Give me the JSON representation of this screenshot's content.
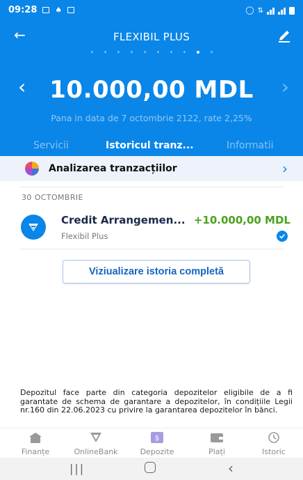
{
  "status_bar": {
    "time": "09:28"
  },
  "header": {
    "title": "FLEXIBIL PLUS",
    "amount": "10.000,00 MDL",
    "subtitle": "Pana in data de 7 octombrie 2122, rate 2,25%",
    "page_dots_total": 10,
    "page_dots_active": 9
  },
  "tabs": [
    {
      "label": "Servicii",
      "active": false
    },
    {
      "label": "Istoricul tranz...",
      "active": true
    },
    {
      "label": "Informatii",
      "active": false
    }
  ],
  "analyze": {
    "label": "Analizarea tranzacțiilor"
  },
  "date_group": "30 OCTOMBRIE",
  "transaction": {
    "title": "Credit Arrangemen...",
    "amount": "+10.000,00 MDL",
    "subtitle": "Flexibil Plus",
    "amount_color": "#4aa21d"
  },
  "full_history_button": "Viziualizare istoria completă",
  "disclaimer": "Depozitul face parte din categoria depozitelor eligibile de a fi garantate de schema de garantare a depozitelor, în condițiile Legii nr.160 din 22.06.2023 cu privire la garantarea depozitelor în bănci.",
  "bottom_nav": [
    {
      "label": "Finanțe",
      "icon": "home-icon"
    },
    {
      "label": "OnlineBank",
      "icon": "onlinebank-logo-icon"
    },
    {
      "label": "Depozite",
      "icon": "deposit-icon",
      "active": true
    },
    {
      "label": "Plați",
      "icon": "wallet-icon"
    },
    {
      "label": "Istoric",
      "icon": "history-icon"
    }
  ],
  "colors": {
    "brand": "#0a86e8",
    "positive": "#4aa21d",
    "link": "#1565c0"
  }
}
